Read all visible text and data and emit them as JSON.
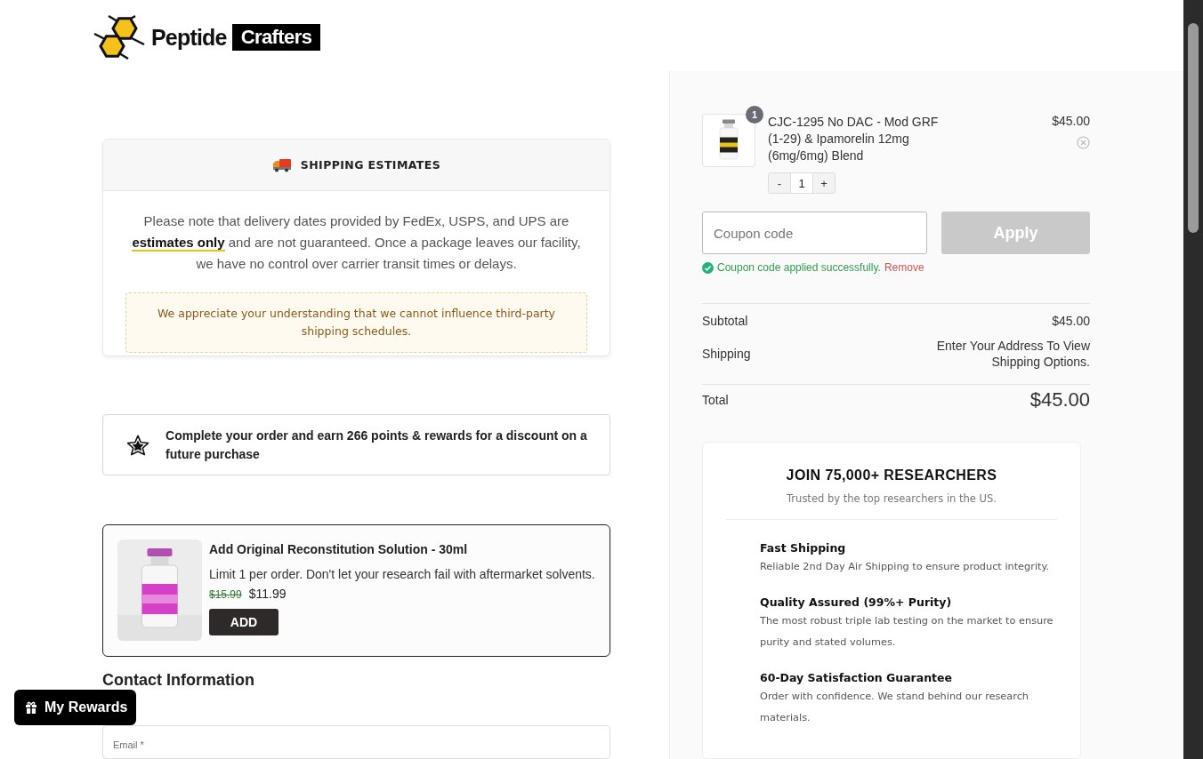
{
  "logo": {
    "word_1": "Peptide",
    "word_2": "Crafters"
  },
  "shipping_estimates": {
    "title": "SHIPPING ESTIMATES",
    "body": "Please note that delivery dates provided by FedEx, USPS, and UPS are **estimates only** and are not guaranteed. Once a package leaves our facility, we have no control over carrier transit times or delays.",
    "notice": "We appreciate your understanding that we cannot influence third-party shipping schedules."
  },
  "rewards_banner": {
    "text": "Complete your order and earn 266 points & rewards for a discount on a future purchase"
  },
  "upsell": {
    "title": "Add Original Reconstitution Solution - 30ml",
    "description": "Limit 1 per order. Don't let your research fail with aftermarket solvents.",
    "old_price": "$15.99",
    "price": "$11.99",
    "button": "ADD"
  },
  "contact": {
    "heading": "Contact Information",
    "email_label": "Email *"
  },
  "rewards_button": {
    "label": "My Rewards"
  },
  "cart": {
    "items": [
      {
        "badge": "1",
        "name": "CJC-1295 No DAC - Mod GRF (1-29) & Ipamorelin 12mg (6mg/6mg) Blend",
        "price": "$45.00",
        "minus": "-",
        "quantity": "1",
        "plus": "+"
      }
    ],
    "coupon": {
      "placeholder": "Coupon code",
      "button": "Apply",
      "button_disabled": true,
      "message": "Coupon code applied successfully.",
      "remove": "Remove"
    },
    "totals": [
      {
        "label": "Subtotal",
        "value": "$45.00"
      },
      {
        "label": "Shipping",
        "value": "Enter Your Address To View Shipping Options."
      }
    ],
    "total": {
      "label": "Total",
      "value": "$45.00"
    }
  },
  "trust": {
    "title": "JOIN 75,000+ RESEARCHERS",
    "subtitle": "Trusted by the top researchers in the US.",
    "features": [
      {
        "title": "Fast Shipping",
        "text": "Reliable 2nd Day Air Shipping to ensure product integrity."
      },
      {
        "title": "Quality Assured (99%+ Purity)",
        "text": "The most robust triple lab testing on the market to ensure purity and stated volumes."
      },
      {
        "title": "60-Day Satisfaction Guarantee",
        "text": "Order with confidence. We stand behind our research materials."
      }
    ]
  }
}
